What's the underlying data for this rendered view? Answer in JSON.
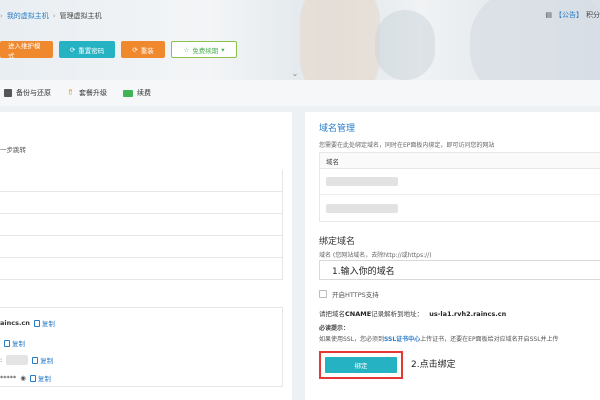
{
  "breadcrumb": {
    "item1": "我的虚拟主机",
    "item2": "管理虚拟主机"
  },
  "notice": {
    "label": "【公告】",
    "text": "积分"
  },
  "buttons": {
    "maintenance": "进入维护模式",
    "reset_password": "重置密码",
    "reinstall": "重装",
    "renew": "免费续期"
  },
  "tabs": {
    "backup": "备份与还原",
    "upgrade": "套餐升级",
    "renew": "续费"
  },
  "left": {
    "hint": "一步跳转",
    "rows": [
      {
        "text": "aincs.cn",
        "copy": "复制"
      },
      {
        "text": "",
        "copy": "复制"
      },
      {
        "text": ":",
        "copy": "复制"
      },
      {
        "text": "*****",
        "copy": "复制"
      }
    ]
  },
  "domain_mgmt": {
    "title": "域名管理",
    "desc": "您需要在此处绑定域名，同时在EP面板内绑定，即可访问您的网站",
    "column": "域名"
  },
  "bind": {
    "title": "绑定域名",
    "hint": "域名 (您网站域名，去除http://或https://)",
    "input_value": "1.输入你的域名",
    "https_label": "开启HTTPS支持",
    "cname_prefix": "请把域名",
    "cname_bold": "CNAME",
    "cname_mid": "记录解析到地址：",
    "cname_target": "us-la1.rvh2.raincs.cn",
    "must_label": "必读提示：",
    "ssl_prefix": "如果使用SSL，您必须到",
    "ssl_link": "SSL证书中心",
    "ssl_suffix": "上传证书，还要在EP面板给对应域名开启SSL并上传",
    "button": "绑定",
    "step2": "2.点击绑定"
  },
  "colors": {
    "teal": "#25b3c4",
    "orange": "#f0892e",
    "link": "#2a7cc7",
    "highlight": "#e53935"
  }
}
